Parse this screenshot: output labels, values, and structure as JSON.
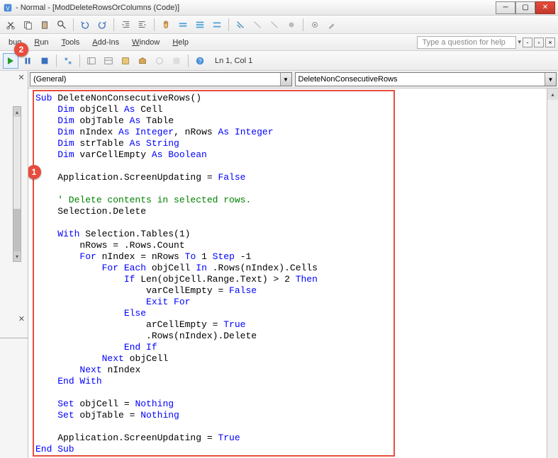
{
  "window": {
    "title": "- Normal - [ModDeleteRowsOrColumns (Code)]"
  },
  "menu": {
    "items": [
      {
        "label": "bug",
        "ul": ""
      },
      {
        "label": "Run",
        "ul": "R"
      },
      {
        "label": "Tools",
        "ul": "T"
      },
      {
        "label": "Add-Ins",
        "ul": "A"
      },
      {
        "label": "Window",
        "ul": "W"
      },
      {
        "label": "Help",
        "ul": "H"
      }
    ],
    "help_placeholder": "Type a question for help"
  },
  "debugbar": {
    "position": "Ln 1, Col 1"
  },
  "dropdowns": {
    "left": "(General)",
    "right": "DeleteNonConsecutiveRows"
  },
  "callouts": {
    "c1": "1",
    "c2": "2"
  },
  "code": {
    "lines": [
      {
        "t": "Sub",
        "c": "kw"
      },
      {
        "t": " DeleteNonConsecutiveRows()",
        "c": ""
      },
      {
        "br": 1
      },
      {
        "t": "    ",
        "c": ""
      },
      {
        "t": "Dim",
        "c": "kw"
      },
      {
        "t": " objCell ",
        "c": ""
      },
      {
        "t": "As",
        "c": "kw"
      },
      {
        "t": " Cell",
        "c": ""
      },
      {
        "br": 1
      },
      {
        "t": "    ",
        "c": ""
      },
      {
        "t": "Dim",
        "c": "kw"
      },
      {
        "t": " objTable ",
        "c": ""
      },
      {
        "t": "As",
        "c": "kw"
      },
      {
        "t": " Table",
        "c": ""
      },
      {
        "br": 1
      },
      {
        "t": "    ",
        "c": ""
      },
      {
        "t": "Dim",
        "c": "kw"
      },
      {
        "t": " nIndex ",
        "c": ""
      },
      {
        "t": "As Integer",
        "c": "kw"
      },
      {
        "t": ", nRows ",
        "c": ""
      },
      {
        "t": "As Integer",
        "c": "kw"
      },
      {
        "br": 1
      },
      {
        "t": "    ",
        "c": ""
      },
      {
        "t": "Dim",
        "c": "kw"
      },
      {
        "t": " strTable ",
        "c": ""
      },
      {
        "t": "As String",
        "c": "kw"
      },
      {
        "br": 1
      },
      {
        "t": "    ",
        "c": ""
      },
      {
        "t": "Dim",
        "c": "kw"
      },
      {
        "t": " varCellEmpty ",
        "c": ""
      },
      {
        "t": "As Boolean",
        "c": "kw"
      },
      {
        "br": 1
      },
      {
        "br": 1
      },
      {
        "t": "    Application.ScreenUpdating = ",
        "c": ""
      },
      {
        "t": "False",
        "c": "kw"
      },
      {
        "br": 1
      },
      {
        "br": 1
      },
      {
        "t": "    ' Delete contents in selected rows.",
        "c": "cm"
      },
      {
        "br": 1
      },
      {
        "t": "    Selection.Delete",
        "c": ""
      },
      {
        "br": 1
      },
      {
        "br": 1
      },
      {
        "t": "    ",
        "c": ""
      },
      {
        "t": "With",
        "c": "kw"
      },
      {
        "t": " Selection.Tables(1)",
        "c": ""
      },
      {
        "br": 1
      },
      {
        "t": "        nRows = .Rows.Count",
        "c": ""
      },
      {
        "br": 1
      },
      {
        "t": "        ",
        "c": ""
      },
      {
        "t": "For",
        "c": "kw"
      },
      {
        "t": " nIndex = nRows ",
        "c": ""
      },
      {
        "t": "To",
        "c": "kw"
      },
      {
        "t": " 1 ",
        "c": ""
      },
      {
        "t": "Step",
        "c": "kw"
      },
      {
        "t": " -1",
        "c": ""
      },
      {
        "br": 1
      },
      {
        "t": "            ",
        "c": ""
      },
      {
        "t": "For Each",
        "c": "kw"
      },
      {
        "t": " objCell ",
        "c": ""
      },
      {
        "t": "In",
        "c": "kw"
      },
      {
        "t": " .Rows(nIndex).Cells",
        "c": ""
      },
      {
        "br": 1
      },
      {
        "t": "                ",
        "c": ""
      },
      {
        "t": "If",
        "c": "kw"
      },
      {
        "t": " Len(objCell.Range.Text) > 2 ",
        "c": ""
      },
      {
        "t": "Then",
        "c": "kw"
      },
      {
        "br": 1
      },
      {
        "t": "                    varCellEmpty = ",
        "c": ""
      },
      {
        "t": "False",
        "c": "kw"
      },
      {
        "br": 1
      },
      {
        "t": "                    ",
        "c": ""
      },
      {
        "t": "Exit For",
        "c": "kw"
      },
      {
        "br": 1
      },
      {
        "t": "                ",
        "c": ""
      },
      {
        "t": "Else",
        "c": "kw"
      },
      {
        "br": 1
      },
      {
        "t": "                    arCellEmpty = ",
        "c": ""
      },
      {
        "t": "True",
        "c": "kw"
      },
      {
        "br": 1
      },
      {
        "t": "                    .Rows(nIndex).Delete",
        "c": ""
      },
      {
        "br": 1
      },
      {
        "t": "                ",
        "c": ""
      },
      {
        "t": "End If",
        "c": "kw"
      },
      {
        "br": 1
      },
      {
        "t": "            ",
        "c": ""
      },
      {
        "t": "Next",
        "c": "kw"
      },
      {
        "t": " objCell",
        "c": ""
      },
      {
        "br": 1
      },
      {
        "t": "        ",
        "c": ""
      },
      {
        "t": "Next",
        "c": "kw"
      },
      {
        "t": " nIndex",
        "c": ""
      },
      {
        "br": 1
      },
      {
        "t": "    ",
        "c": ""
      },
      {
        "t": "End With",
        "c": "kw"
      },
      {
        "br": 1
      },
      {
        "br": 1
      },
      {
        "t": "    ",
        "c": ""
      },
      {
        "t": "Set",
        "c": "kw"
      },
      {
        "t": " objCell = ",
        "c": ""
      },
      {
        "t": "Nothing",
        "c": "kw"
      },
      {
        "br": 1
      },
      {
        "t": "    ",
        "c": ""
      },
      {
        "t": "Set",
        "c": "kw"
      },
      {
        "t": " objTable = ",
        "c": ""
      },
      {
        "t": "Nothing",
        "c": "kw"
      },
      {
        "br": 1
      },
      {
        "br": 1
      },
      {
        "t": "    Application.ScreenUpdating = ",
        "c": ""
      },
      {
        "t": "True",
        "c": "kw"
      },
      {
        "br": 1
      },
      {
        "t": "End Sub",
        "c": "kw"
      }
    ]
  }
}
